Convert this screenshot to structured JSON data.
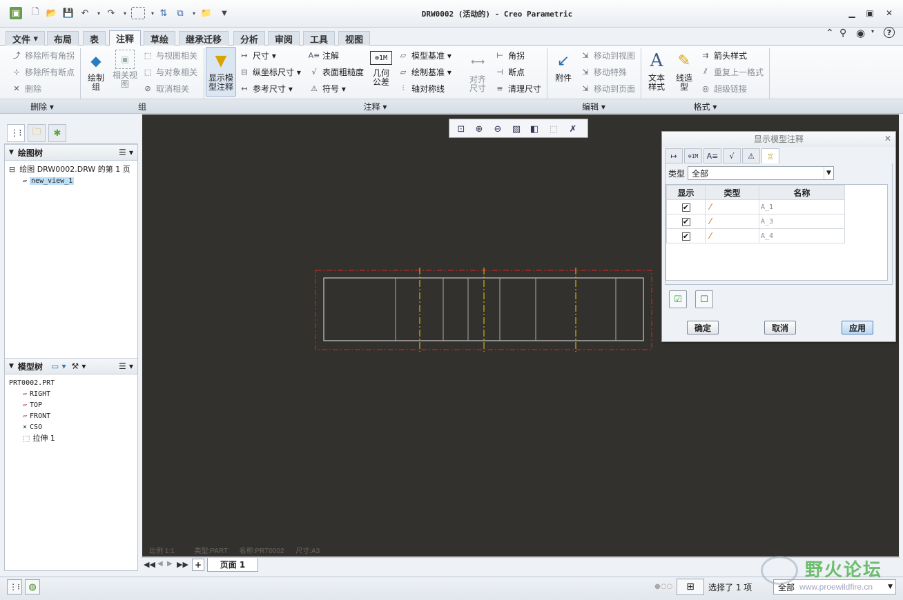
{
  "window": {
    "title": "DRW0002 (活动的) - Creo Parametric",
    "controls": {
      "minimize": "▭",
      "restore": "▣",
      "close": "✕"
    }
  },
  "quick_access": [
    "new-icon",
    "open-icon",
    "save-icon",
    "undo-icon",
    "redo-icon",
    "select-box-icon",
    "regenerate-icon",
    "windows-icon",
    "close-window-icon"
  ],
  "ribbon": {
    "tabs": [
      "文件",
      "布局",
      "表",
      "注释",
      "草绘",
      "继承迁移",
      "分析",
      "审阅",
      "工具",
      "视图"
    ],
    "active_tab": "注释",
    "groups": {
      "delete": {
        "label": "删除 ▾",
        "items": [
          "移除所有角拐",
          "移除所有断点",
          "删除"
        ]
      },
      "group": {
        "label": "组",
        "draw_group": "绘制\n组",
        "related_view": "相关视\n图",
        "items": [
          "与视图相关",
          "与对象相关",
          "取消相关"
        ]
      },
      "annotate": {
        "label": "注释 ▾",
        "show_model_annot": "显示模\n型注释",
        "col1": [
          "尺寸 ▾",
          "纵坐标尺寸 ▾",
          "参考尺寸 ▾"
        ],
        "col2": [
          "注解",
          "表面粗糙度",
          "符号 ▾"
        ],
        "geom_tol": "几何\n公差",
        "col3": [
          "模型基准 ▾",
          "绘制基准 ▾",
          "轴对称线"
        ],
        "align_dim": "对齐\n尺寸",
        "col4": [
          "角拐",
          "断点",
          "清理尺寸"
        ]
      },
      "edit": {
        "label": "编辑 ▾",
        "attach": "附件",
        "items": [
          "移动到视图",
          "移动特殊",
          "移动到页面"
        ]
      },
      "format": {
        "label": "格式 ▾",
        "text_style": "文本\n样式",
        "line_style": "线造\n型",
        "items": [
          "箭头样式",
          "重复上一格式",
          "超级链接"
        ]
      }
    }
  },
  "drawing_tree": {
    "title": "绘图树",
    "nodes": [
      "绘图 DRW0002.DRW 的第 1 页",
      "new_view_1"
    ]
  },
  "model_tree": {
    "title": "模型树",
    "nodes": [
      "PRT0002.PRT",
      "RIGHT",
      "TOP",
      "FRONT",
      "CSO",
      "拉伸 1"
    ]
  },
  "canvas": {
    "status_scale": "比例 1:1",
    "status_type": "类型:PART",
    "status_name": "名称:PRT0002",
    "status_size": "尺寸:A3",
    "background": "#33312d"
  },
  "page_bar": {
    "page_label": "页面 1",
    "add": "+"
  },
  "dialog": {
    "title": "显示模型注释",
    "type_label": "类型",
    "type_value": "全部",
    "columns": [
      "显示",
      "类型",
      "名称"
    ],
    "rows": [
      {
        "checked": true,
        "name": "A_1"
      },
      {
        "checked": true,
        "name": "A_3"
      },
      {
        "checked": true,
        "name": "A_4"
      }
    ],
    "ok": "确定",
    "cancel": "取消",
    "apply": "应用"
  },
  "status_bar": {
    "selection_text": "选择了 1 项",
    "filter_value": "全部"
  },
  "watermark": {
    "text": "野火论坛",
    "url": "www.proewildfire.cn"
  }
}
